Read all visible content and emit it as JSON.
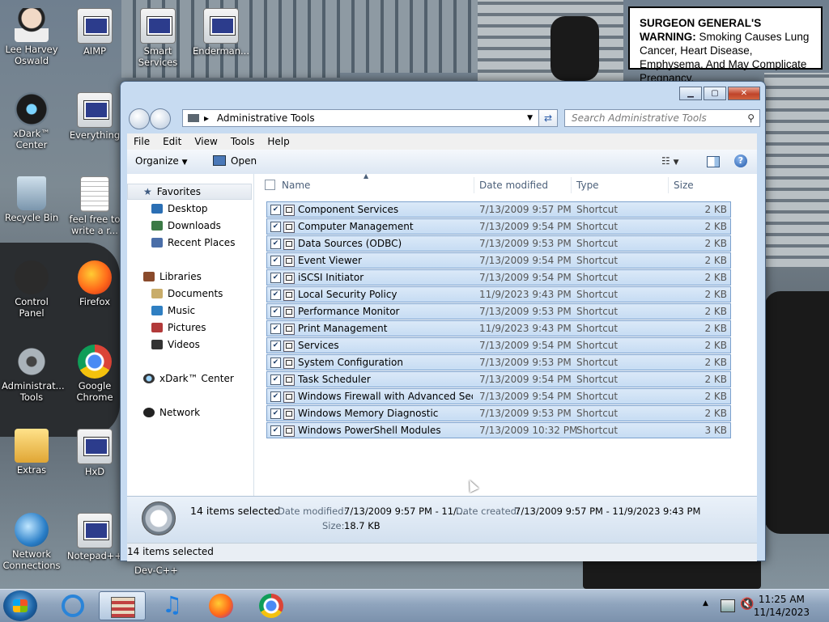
{
  "warning": {
    "bold": "SURGEON GENERAL'S WARNING:",
    "text": " Smoking Causes Lung Cancer, Heart Disease, Emphysema, And May Complicate Pregnancy."
  },
  "desktop_icons": [
    {
      "label": "Lee Harvey Oswald"
    },
    {
      "label": "AIMP"
    },
    {
      "label": "Smart Services"
    },
    {
      "label": "Enderman..."
    },
    {
      "label": "xDark™ Center"
    },
    {
      "label": "Everything"
    },
    {
      "label": "Recycle Bin"
    },
    {
      "label": "feel free to write a r..."
    },
    {
      "label": "Control Panel"
    },
    {
      "label": "Firefox"
    },
    {
      "label": "Administrat... Tools"
    },
    {
      "label": "Google Chrome"
    },
    {
      "label": "Extras"
    },
    {
      "label": "HxD"
    },
    {
      "label": "Network Connections"
    },
    {
      "label": "Notepad++"
    },
    {
      "label": "Dev-C++"
    }
  ],
  "window": {
    "address": "Administrative Tools",
    "search_placeholder": "Search Administrative Tools",
    "menu": [
      "File",
      "Edit",
      "View",
      "Tools",
      "Help"
    ],
    "organize": "Organize",
    "open": "Open",
    "nav": {
      "favorites": "Favorites",
      "desktop": "Desktop",
      "downloads": "Downloads",
      "recent": "Recent Places",
      "libraries": "Libraries",
      "documents": "Documents",
      "music": "Music",
      "pictures": "Pictures",
      "videos": "Videos",
      "xdark": "xDark™ Center",
      "network": "Network"
    },
    "columns": {
      "name": "Name",
      "date": "Date modified",
      "type": "Type",
      "size": "Size"
    },
    "files": [
      {
        "name": "Component Services",
        "date": "7/13/2009 9:57 PM",
        "type": "Shortcut",
        "size": "2 KB"
      },
      {
        "name": "Computer Management",
        "date": "7/13/2009 9:54 PM",
        "type": "Shortcut",
        "size": "2 KB"
      },
      {
        "name": "Data Sources (ODBC)",
        "date": "7/13/2009 9:53 PM",
        "type": "Shortcut",
        "size": "2 KB"
      },
      {
        "name": "Event Viewer",
        "date": "7/13/2009 9:54 PM",
        "type": "Shortcut",
        "size": "2 KB"
      },
      {
        "name": "iSCSI Initiator",
        "date": "7/13/2009 9:54 PM",
        "type": "Shortcut",
        "size": "2 KB"
      },
      {
        "name": "Local Security Policy",
        "date": "11/9/2023 9:43 PM",
        "type": "Shortcut",
        "size": "2 KB"
      },
      {
        "name": "Performance Monitor",
        "date": "7/13/2009 9:53 PM",
        "type": "Shortcut",
        "size": "2 KB"
      },
      {
        "name": "Print Management",
        "date": "11/9/2023 9:43 PM",
        "type": "Shortcut",
        "size": "2 KB"
      },
      {
        "name": "Services",
        "date": "7/13/2009 9:54 PM",
        "type": "Shortcut",
        "size": "2 KB"
      },
      {
        "name": "System Configuration",
        "date": "7/13/2009 9:53 PM",
        "type": "Shortcut",
        "size": "2 KB"
      },
      {
        "name": "Task Scheduler",
        "date": "7/13/2009 9:54 PM",
        "type": "Shortcut",
        "size": "2 KB"
      },
      {
        "name": "Windows Firewall with Advanced Secu...",
        "date": "7/13/2009 9:54 PM",
        "type": "Shortcut",
        "size": "2 KB"
      },
      {
        "name": "Windows Memory Diagnostic",
        "date": "7/13/2009 9:53 PM",
        "type": "Shortcut",
        "size": "2 KB"
      },
      {
        "name": "Windows PowerShell Modules",
        "date": "7/13/2009 10:32 PM",
        "type": "Shortcut",
        "size": "3 KB"
      }
    ],
    "details": {
      "selected": "14 items selected",
      "modified_label": "Date modified:",
      "modified_value": "7/13/2009 9:57 PM - 11/...",
      "created_label": "Date created:",
      "created_value": "7/13/2009 9:57 PM - 11/9/2023 9:43 PM",
      "size_label": "Size:",
      "size_value": "18.7 KB"
    },
    "status": "14 items selected"
  },
  "taskbar": {
    "time": "11:25 AM",
    "date": "11/14/2023"
  }
}
